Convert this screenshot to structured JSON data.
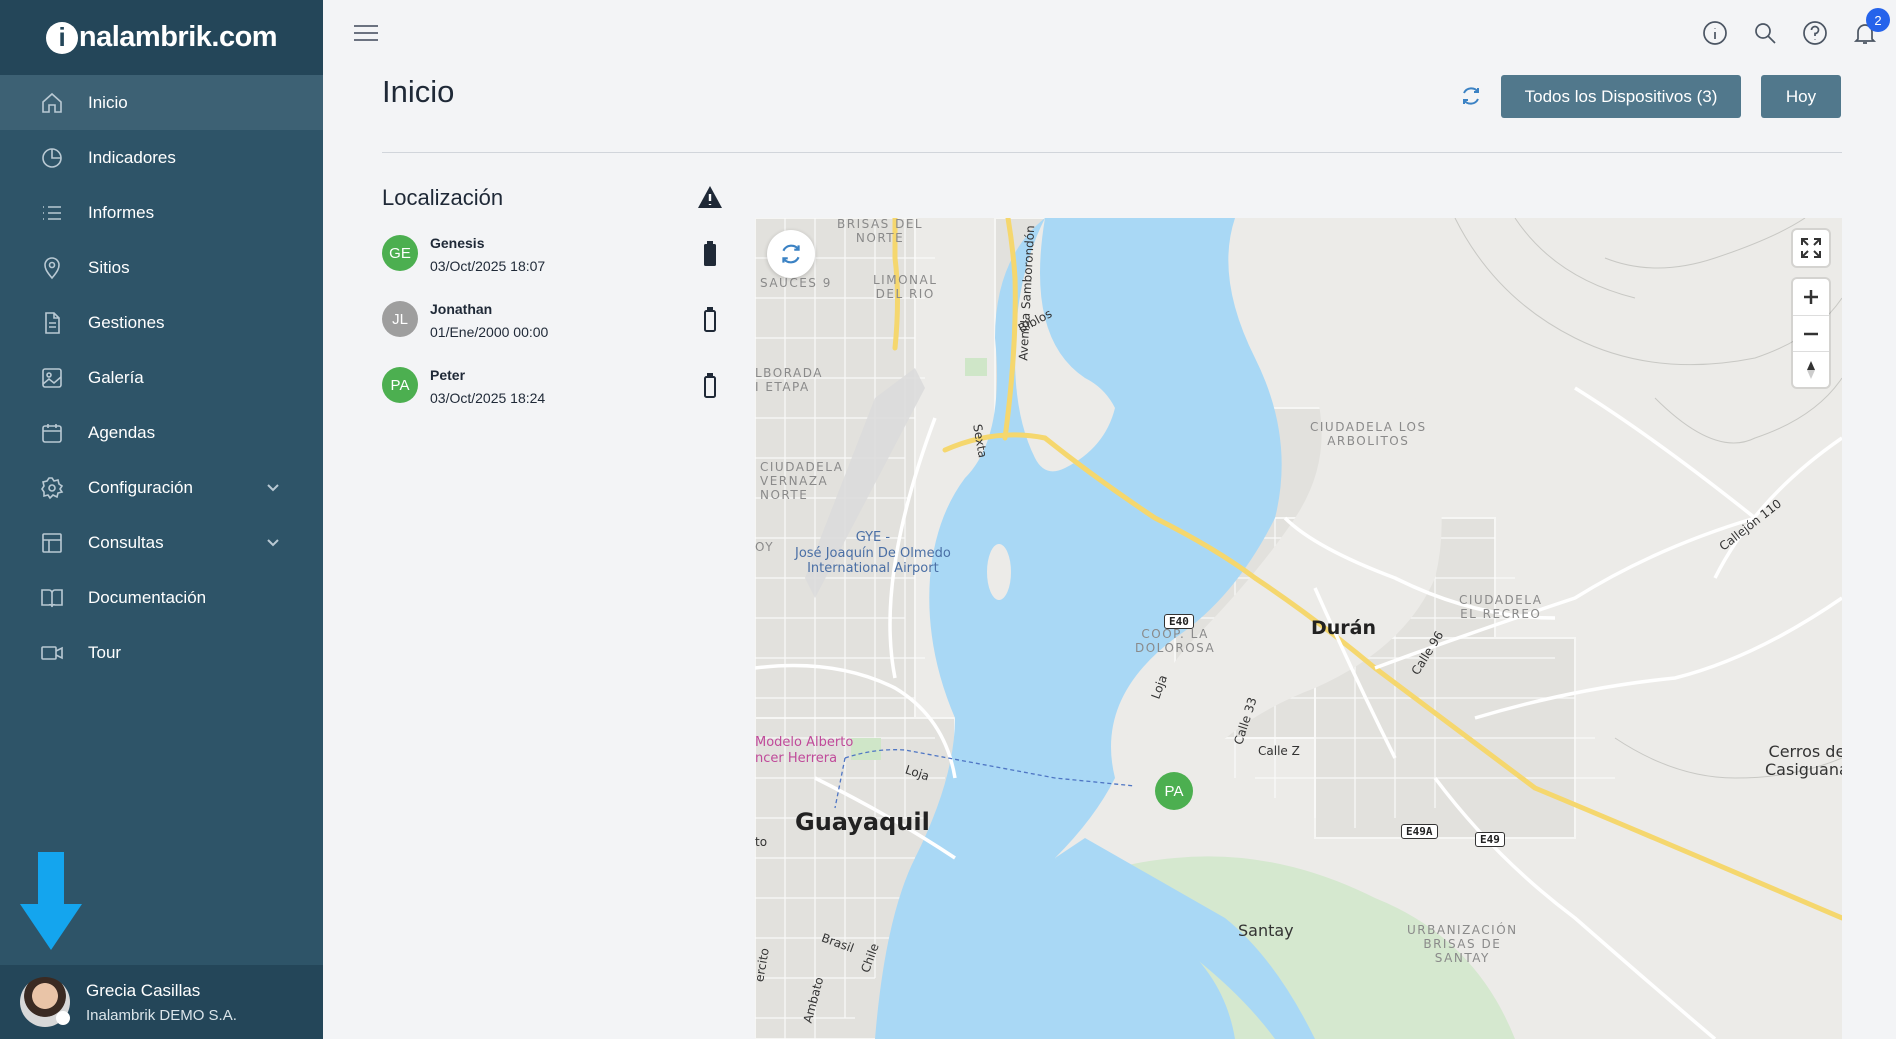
{
  "app": {
    "logo_text": "nalambrik.com",
    "logo_letter": "i"
  },
  "sidebar": {
    "items": [
      {
        "label": "Inicio",
        "icon": "home-icon",
        "active": true
      },
      {
        "label": "Indicadores",
        "icon": "pie-chart-icon"
      },
      {
        "label": "Informes",
        "icon": "list-icon"
      },
      {
        "label": "Sitios",
        "icon": "location-pin-icon"
      },
      {
        "label": "Gestiones",
        "icon": "document-icon"
      },
      {
        "label": "Galería",
        "icon": "image-icon"
      },
      {
        "label": "Agendas",
        "icon": "calendar-icon"
      },
      {
        "label": "Configuración",
        "icon": "gear-icon",
        "expandable": true
      },
      {
        "label": "Consultas",
        "icon": "table-icon",
        "expandable": true
      },
      {
        "label": "Documentación",
        "icon": "book-icon"
      },
      {
        "label": "Tour",
        "icon": "video-camera-icon"
      }
    ]
  },
  "user": {
    "name": "Grecia Casillas",
    "company": "Inalambrik DEMO S.A."
  },
  "topbar": {
    "notification_count": "2"
  },
  "header": {
    "title": "Inicio",
    "devices_button": "Todos los Dispositivos (3)",
    "today_button": "Hoy"
  },
  "location": {
    "title": "Localización",
    "devices": [
      {
        "initials": "GE",
        "name": "Genesis",
        "date": "03/Oct/2025 18:07",
        "color": "#4caf50",
        "battery": "full"
      },
      {
        "initials": "JL",
        "name": "Jonathan",
        "date": "01/Ene/2000 00:00",
        "color": "#9e9e9e",
        "battery": "empty"
      },
      {
        "initials": "PA",
        "name": "Peter",
        "date": "03/Oct/2025 18:24",
        "color": "#4caf50",
        "battery": "empty"
      }
    ]
  },
  "map": {
    "labels": {
      "brisas": "BRISAS DEL\nNORTE",
      "sauces": "SAUCES 9",
      "limonal": "LIMONAL\nDEL RIO",
      "biblos": "Biblos",
      "samborondon": "Avenida Samborondón",
      "alborada": "LBORADA\nI ETAPA",
      "sexta": "Sexta",
      "vernaza": "CIUDADELA\nVERNAZA\nNORTE",
      "gye": "GYE -\nJosé Joaquín De Olmedo\nInternational Airport",
      "oy": "OY",
      "arbolitos": "CIUDADELA LOS\nARBOLITOS",
      "callejon": "Callejón 110",
      "recreo": "CIUDADELA\nEL RECREO",
      "coop": "COOP. LA\nDOLOROSA",
      "duran": "Durán",
      "calle96": "Calle 96",
      "loja1": "Loja",
      "calle33": "Calle 33",
      "callez": "Calle Z",
      "modelo": "Modelo Alberto\nncer Herrera",
      "loja2": "Loja",
      "guayaquil": "Guayaquil",
      "cerros": "Cerros de\nCasiguana",
      "santay": "Santay",
      "urbanizacion": "URBANIZACIÓN\nBRISAS DE\nSANTAY",
      "brasil": "Brasil",
      "chile": "Chile",
      "ercito": "ercito",
      "ambato": "Ambato",
      "to": "to",
      "e40": "E40",
      "e49a": "E49A",
      "e49": "E49"
    },
    "pin": "PA"
  },
  "colors": {
    "sidebar": "#2e5468",
    "accent": "#51788c",
    "water": "#a9d8f5"
  }
}
